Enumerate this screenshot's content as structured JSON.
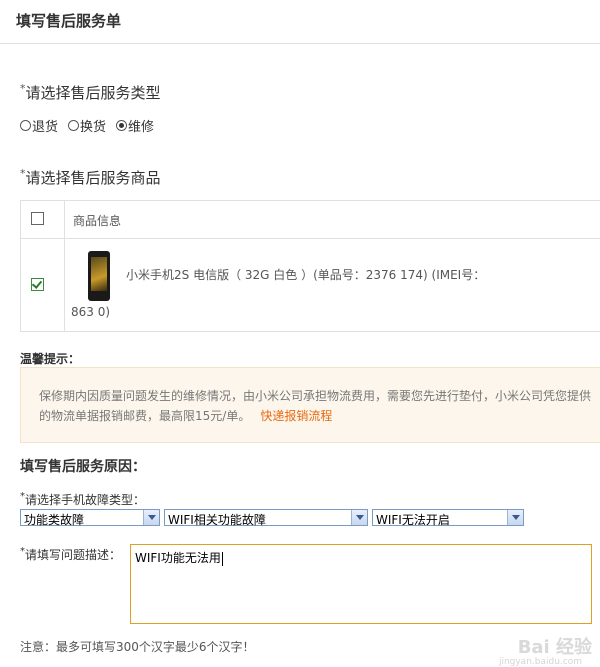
{
  "header": {
    "title": "填写售后服务单"
  },
  "service_type": {
    "star": "*",
    "title": "请选择售后服务类型",
    "options": [
      {
        "label": "退货",
        "checked": false
      },
      {
        "label": "换货",
        "checked": false
      },
      {
        "label": "维修",
        "checked": true
      }
    ]
  },
  "product_section": {
    "star": "*",
    "title": "请选择售后服务商品",
    "table": {
      "header_label": "商品信息",
      "row": {
        "line1": "小米手机2S 电信版（ 32G 白色 ）(单品号：2376        174) (IMEI号：",
        "line2": "863                0)"
      }
    }
  },
  "tip": {
    "label": "温馨提示：",
    "text": "保修期内因质量问题发生的维修情况，由小米公司承担物流费用，需要您先进行垫付，小米公司凭您提供的物流单据报销邮费，最高限15元/单。",
    "link": "快递报销流程"
  },
  "reason": {
    "title": "填写售后服务原因：",
    "fault_label_star": "*",
    "fault_label": "请选择手机故障类型：",
    "selects": [
      "功能类故障",
      "WIFI相关功能故障",
      "WIFI无法开启"
    ],
    "desc_label_star": "*",
    "desc_label": "请填写问题描述：",
    "desc_value": "WIFI功能无法用"
  },
  "note": "注意：最多可填写300个汉字最少6个汉字！",
  "watermark": {
    "brand": "Bai 经验",
    "url": "jingyan.baidu.com"
  }
}
